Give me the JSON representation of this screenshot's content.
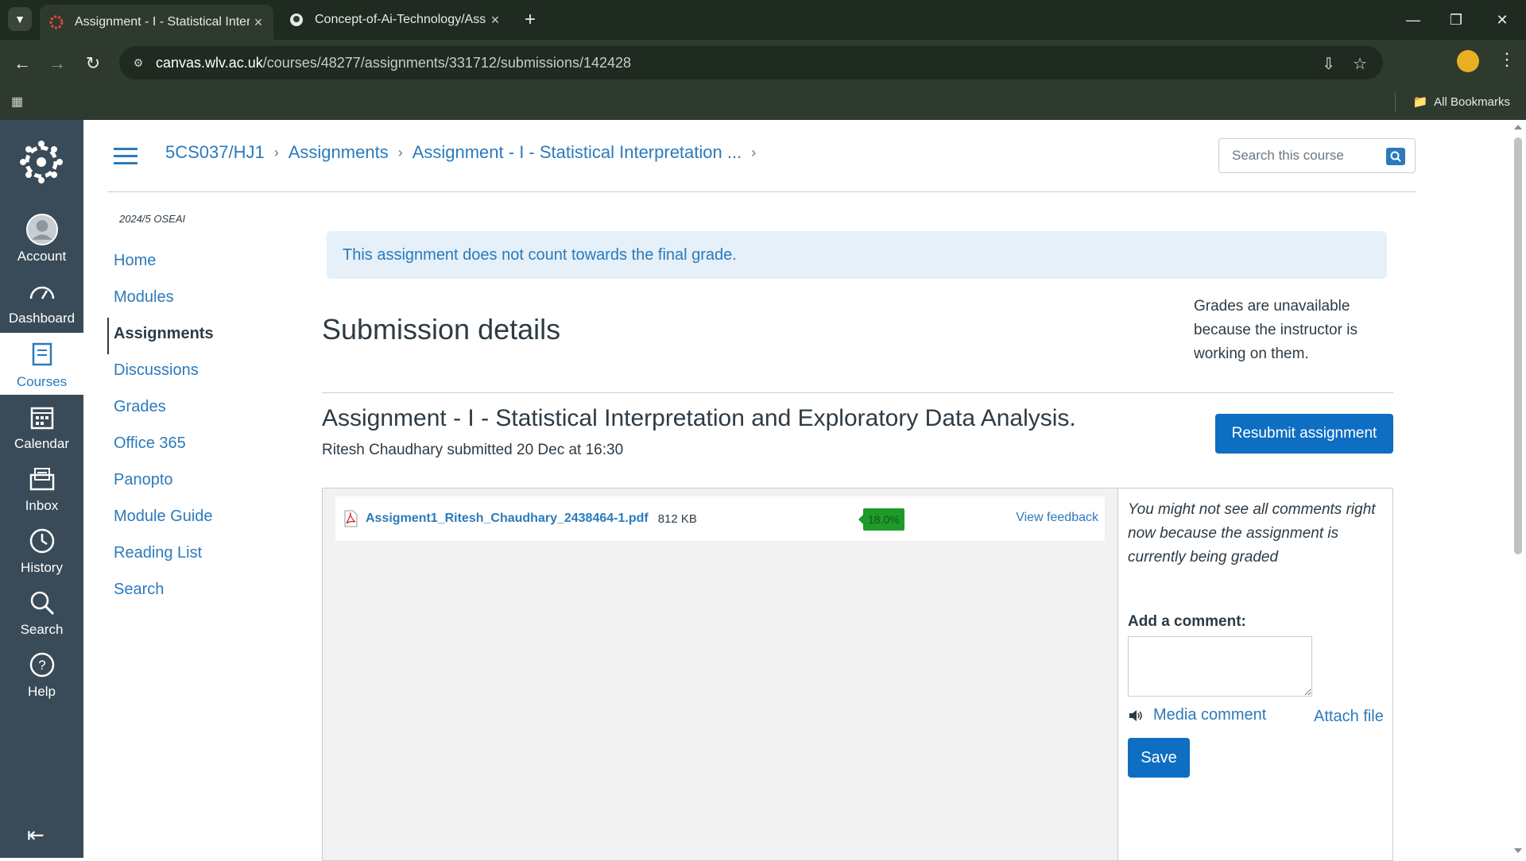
{
  "browser": {
    "tabs": [
      {
        "title": "Assignment - I - Statistical Inter",
        "active": true
      },
      {
        "title": "Concept-of-Ai-Technology/Assi",
        "active": false
      }
    ],
    "url_host": "canvas.wlv.ac.uk",
    "url_path": "/courses/48277/assignments/331712/submissions/142428",
    "bookmarks_label": "All Bookmarks"
  },
  "global_nav": {
    "items": [
      {
        "label": "Account",
        "icon": "account-icon"
      },
      {
        "label": "Dashboard",
        "icon": "dashboard-icon"
      },
      {
        "label": "Courses",
        "icon": "courses-icon",
        "active": true
      },
      {
        "label": "Calendar",
        "icon": "calendar-icon"
      },
      {
        "label": "Inbox",
        "icon": "inbox-icon"
      },
      {
        "label": "History",
        "icon": "history-icon"
      },
      {
        "label": "Search",
        "icon": "search-icon"
      },
      {
        "label": "Help",
        "icon": "help-icon"
      }
    ]
  },
  "header": {
    "breadcrumbs": [
      "5CS037/HJ1",
      "Assignments",
      "Assignment - I - Statistical Interpretation ..."
    ],
    "search_placeholder": "Search this course"
  },
  "course_nav": {
    "term": "2024/5 OSEAI",
    "items": [
      "Home",
      "Modules",
      "Assignments",
      "Discussions",
      "Grades",
      "Office 365",
      "Panopto",
      "Module Guide",
      "Reading List",
      "Search"
    ],
    "active": "Assignments"
  },
  "main": {
    "notice": "This assignment does not count towards the final grade.",
    "heading": "Submission details",
    "grade_note": "Grades are unavailable because the instructor is working on them.",
    "assignment_title": "Assignment - I - Statistical Interpretation and Exploratory Data Analysis.",
    "submitted_text": "Ritesh Chaudhary submitted 20 Dec at 16:30",
    "resubmit_label": "Resubmit assignment"
  },
  "file": {
    "name": "Assigment1_Ritesh_Chaudhary_2438464-1.pdf",
    "size": "812 KB",
    "score": "18.0%",
    "view_feedback": "View feedback"
  },
  "comments": {
    "note": "You might not see all comments right now because the assignment is currently being graded",
    "add_label": "Add a comment:",
    "media_label": "Media comment",
    "attach_label": "Attach file",
    "save_label": "Save"
  },
  "colors": {
    "canvas_nav": "#394b58",
    "link_blue": "#2b7abc",
    "button_blue": "#0d6ec2",
    "score_green": "#1d9a2a"
  }
}
